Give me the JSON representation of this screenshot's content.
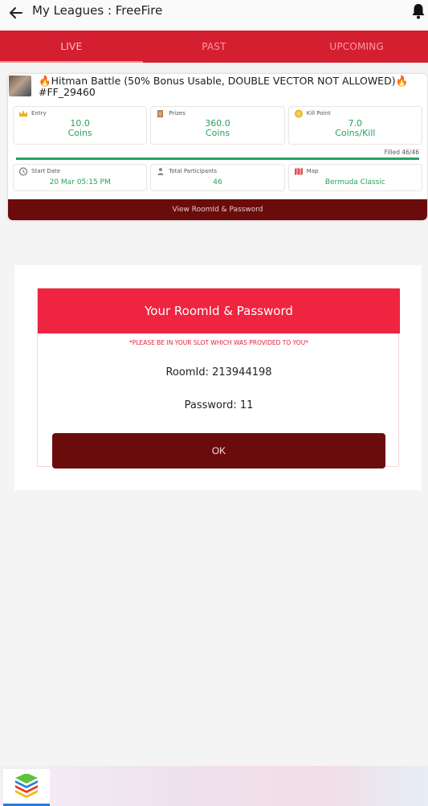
{
  "header": {
    "title": "My Leagues : FreeFire",
    "back_icon": "arrow-left-icon",
    "notification_icon": "bell-icon"
  },
  "tabs": [
    {
      "label": "LIVE",
      "active": true
    },
    {
      "label": "PAST",
      "active": false
    },
    {
      "label": "UPCOMING",
      "active": false
    }
  ],
  "league": {
    "title": "Hitman  Battle (50% Bonus Usable, DOUBLE VECTOR NOT ALLOWED)",
    "code": "#FF_29460",
    "entry_label": "Entry",
    "entry_value": "10.0",
    "entry_unit": "Coins",
    "prizes_label": "Prizes",
    "prizes_value": "360.0",
    "prizes_unit": "Coins",
    "kill_label": "Kill Point",
    "kill_value": "7.0",
    "kill_unit": "Coins/Kill",
    "filled_text": "Filled 46/46",
    "filled_fraction": 1.0,
    "start_label": "Start Date",
    "start_value": "20 Mar 05:15 PM",
    "participants_label": "Total Participants",
    "participants_value": "46",
    "map_label": "Map",
    "map_value": "Bermuda Classic",
    "button_label": "View RoomId & Password"
  },
  "dialog": {
    "title": "Your RoomId & Password",
    "note": "*PLEASE BE IN YOUR SLOT WHICH WAS PROVIDED TO YOU*",
    "room_id": "RoomId: 213944198",
    "password": "Password: 11",
    "ok_label": "OK"
  },
  "colors": {
    "tab_bar": "#d31f30",
    "dialog_header": "#ee2440",
    "dark_button": "#6b0c0c",
    "value_green": "#25a35a"
  }
}
